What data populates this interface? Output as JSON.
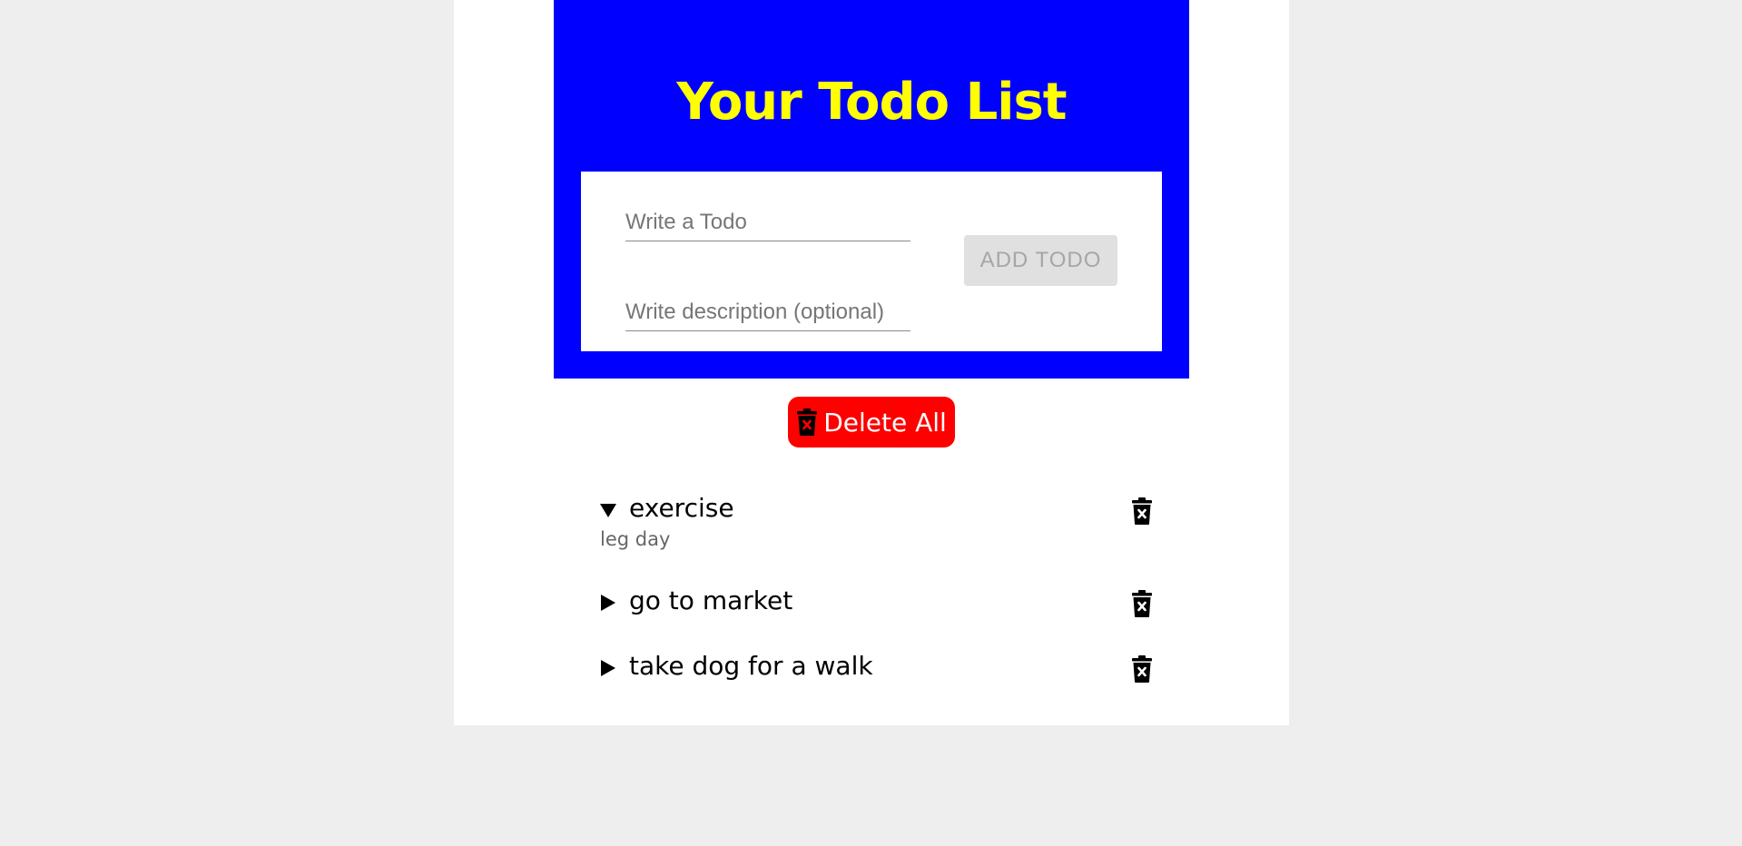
{
  "header": {
    "title": "Your Todo List",
    "background_color": "#0000ff",
    "title_color": "#ffff00"
  },
  "form": {
    "todo_placeholder": "Write a Todo",
    "todo_value": "",
    "description_placeholder": "Write description (optional)",
    "description_value": "",
    "add_button_label": "ADD TODO",
    "add_button_state": "disabled"
  },
  "delete_all": {
    "label": "Delete All",
    "icon": "trash-x-icon",
    "color": "#ff0000"
  },
  "todos": [
    {
      "title": "exercise",
      "description": "leg day",
      "expanded": true,
      "expand_icon": "caret-down-icon",
      "delete_icon": "trash-x-icon"
    },
    {
      "title": "go to market",
      "description": "",
      "expanded": false,
      "expand_icon": "caret-right-icon",
      "delete_icon": "trash-x-icon"
    },
    {
      "title": "take dog for a walk",
      "description": "",
      "expanded": false,
      "expand_icon": "caret-right-icon",
      "delete_icon": "trash-x-icon"
    }
  ]
}
